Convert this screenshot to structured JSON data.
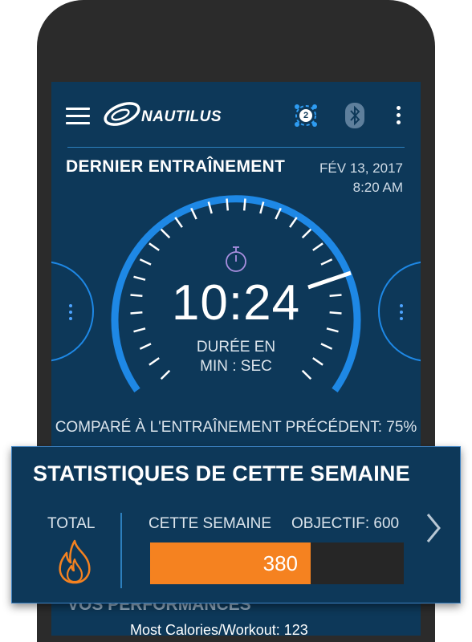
{
  "app": {
    "brand": "NAUTILUS",
    "sync_count": "2"
  },
  "last_workout": {
    "title": "DERNIER ENTRAÎNEMENT",
    "date": "FÉV 13, 2017",
    "time": "8:20 AM",
    "duration": "10:24",
    "duration_unit_line1": "DURÉE EN",
    "duration_unit_line2": "MIN : SEC",
    "comparison": "COMPARÉ À L'ENTRAÎNEMENT PRÉCÉDENT: 75%",
    "comparison_percent": 75
  },
  "weekly_stats": {
    "title": "STATISTIQUES DE CETTE SEMAINE",
    "total_label": "TOTAL",
    "this_week_label": "CETTE SEMAINE",
    "goal_label": "OBJECTIF: 600",
    "value": "380",
    "progress_fraction": 0.633
  },
  "performances": {
    "title": "VOS PERFORMANCES",
    "partial_text": "Most Calories/Workout: 123"
  },
  "colors": {
    "background": "#0d3859",
    "accent_blue": "#1e88e5",
    "orange": "#f58220",
    "flame_icon": "#f58220"
  },
  "icons": [
    "menu-icon",
    "sync-icon",
    "bluetooth-icon",
    "more-vertical-icon",
    "stopwatch-icon",
    "flame-icon",
    "chevron-right-icon"
  ]
}
